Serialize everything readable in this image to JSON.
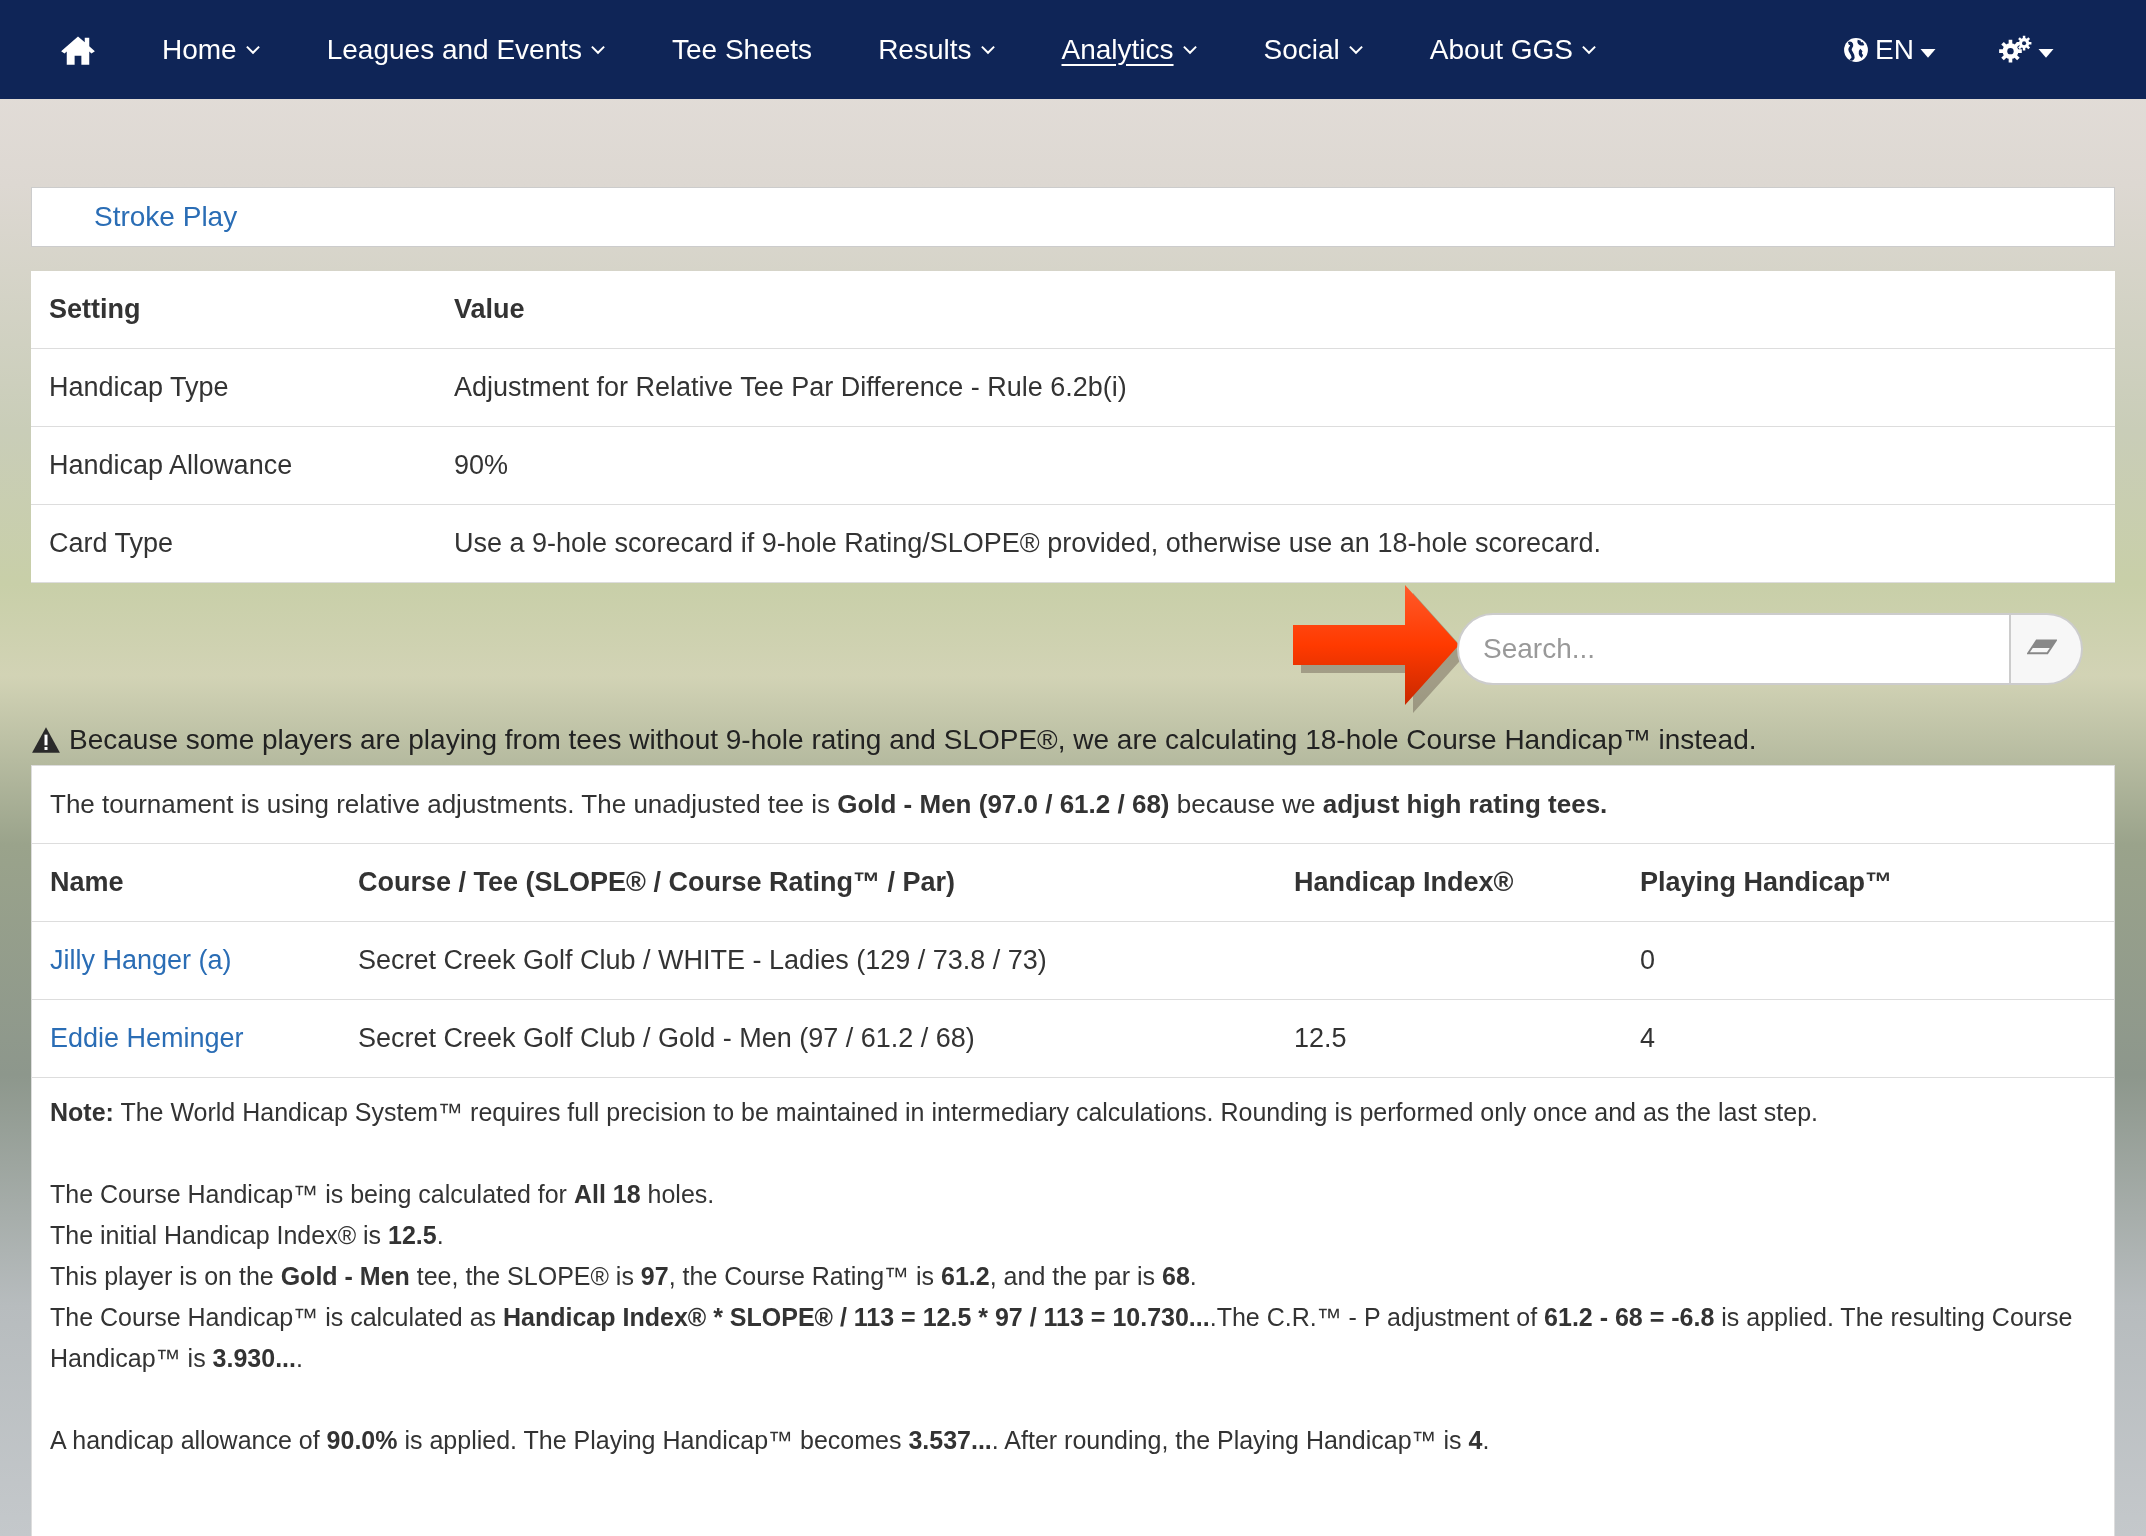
{
  "nav": {
    "items": [
      {
        "label": "Home",
        "dropdown": true,
        "selected": false
      },
      {
        "label": "Leagues and Events",
        "dropdown": true,
        "selected": false
      },
      {
        "label": "Tee Sheets",
        "dropdown": false,
        "selected": false
      },
      {
        "label": "Results",
        "dropdown": true,
        "selected": false
      },
      {
        "label": "Analytics",
        "dropdown": true,
        "selected": true
      },
      {
        "label": "Social",
        "dropdown": true,
        "selected": false
      },
      {
        "label": "About GGS",
        "dropdown": true,
        "selected": false
      }
    ],
    "language": "EN"
  },
  "format_tab": {
    "label": "Stroke Play"
  },
  "settings": {
    "columns": [
      "Setting",
      "Value"
    ],
    "rows": [
      {
        "setting": "Handicap Type",
        "value": "Adjustment for Relative Tee Par Difference - Rule 6.2b(i)"
      },
      {
        "setting": "Handicap Allowance",
        "value": "90%"
      },
      {
        "setting": "Card Type",
        "value": "Use a 9-hole scorecard if 9-hole Rating/SLOPE® provided, otherwise use an 18-hole scorecard."
      }
    ]
  },
  "search": {
    "placeholder": "Search..."
  },
  "warning": "Because some players are playing from tees without 9-hole rating and SLOPE®, we are calculating 18-hole Course Handicap™ instead.",
  "players": {
    "intro": "The tournament is using relative adjustments. The unadjusted tee is **Gold - Men (97.0 / 61.2 / 68)** because we **adjust high rating tees.**",
    "columns": [
      "Name",
      "Course / Tee (SLOPE® / Course Rating™ / Par)",
      "Handicap Index®",
      "Playing Handicap™"
    ],
    "rows": [
      {
        "name": "Jilly Hanger (a)",
        "course": "Secret Creek Golf Club / WHITE - Ladies (129 / 73.8 / 73)",
        "playing": "0"
      },
      {
        "name": "Eddie Heminger",
        "course": "Secret Creek Golf Club / Gold - Men (97 / 61.2 / 68)",
        "index": "12.5",
        "playing": "4"
      }
    ],
    "notes": [
      [
        "**Note:** The World Handicap System™ requires full precision to be maintained in intermediary calculations. Rounding is performed only once and as the last step."
      ],
      [
        "The Course Handicap™ is being calculated for **All 18** holes.",
        "The initial Handicap Index® is **12.5**.",
        "This player is on the **Gold - Men** tee, the SLOPE® is **97**, the Course Rating™ is **61.2**, and the par is **68**.",
        "The Course Handicap™ is calculated as **Handicap Index® * SLOPE® / 113 = 12.5 * 97 / 113 = 10.730...**.The C.R.™ - P adjustment of **61.2 - 68 = -6.8** is applied. The resulting Course Handicap™ is **3.930...**."
      ],
      [
        "A handicap allowance of **90.0%** is applied. The Playing Handicap™ becomes **3.537...**. After rounding, the Playing Handicap™ is **4**."
      ]
    ]
  }
}
